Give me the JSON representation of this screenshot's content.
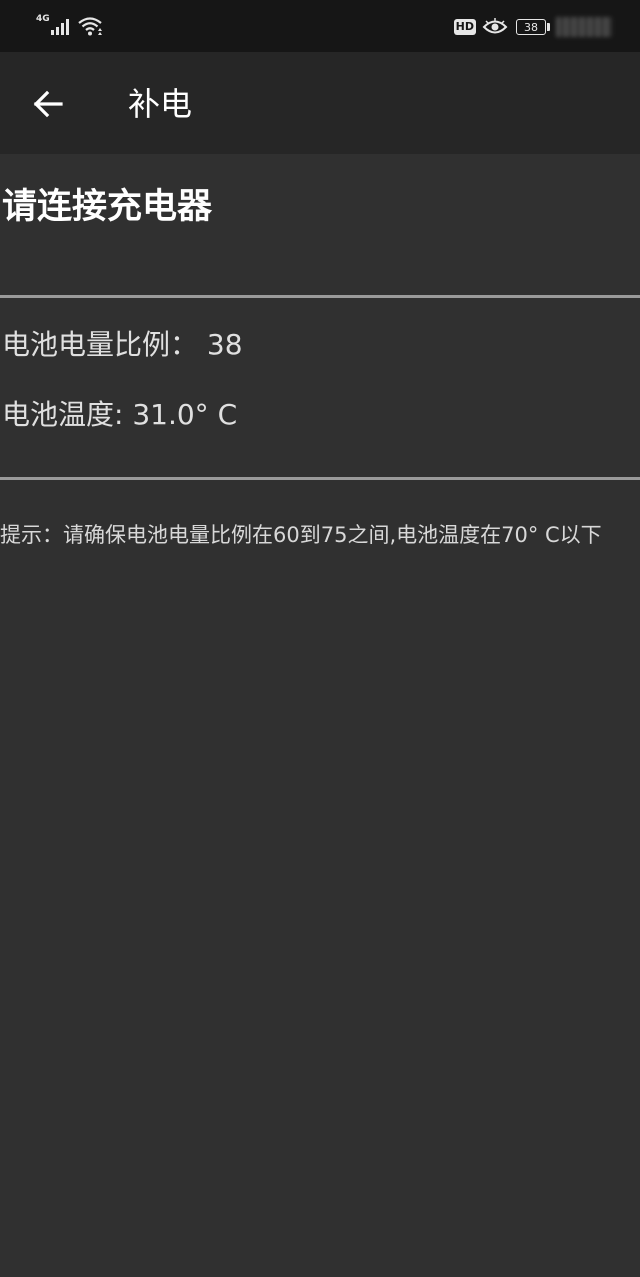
{
  "status_bar": {
    "network_type": "4G",
    "hd_badge": "HD",
    "battery_level": "38",
    "icons": [
      "signal-icon",
      "wifi-icon",
      "eye-comfort-icon",
      "battery-icon"
    ]
  },
  "app_bar": {
    "title": "补电",
    "back_icon": "arrow-back-icon"
  },
  "main": {
    "heading": "请连接充电器",
    "battery_ratio": "电池电量比例： 38",
    "battery_temperature": "电池温度: 31.0° C",
    "hint": "提示：请确保电池电量比例在60到75之间,电池温度在70° C以下"
  },
  "colors": {
    "status_bar_bg": "#161616",
    "app_bar_bg": "#262626",
    "page_bg": "#303030",
    "divider": "#9a9a9a"
  }
}
